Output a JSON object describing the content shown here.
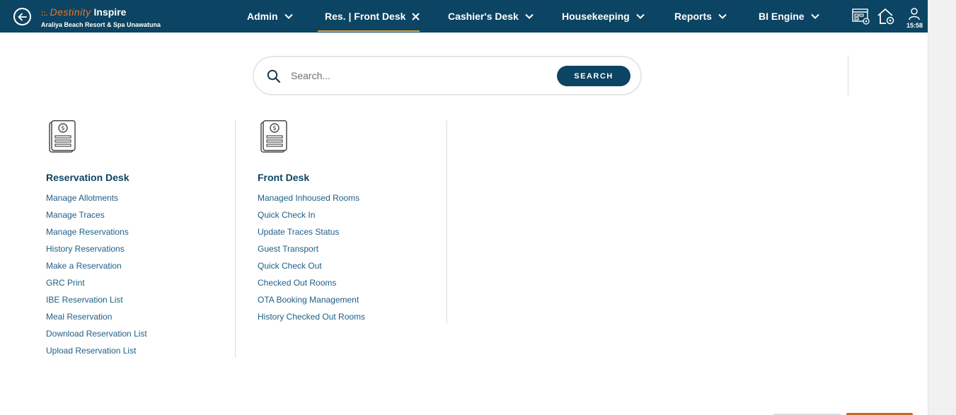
{
  "brand": {
    "logo_mark": "::.",
    "name_part1": "Destinity",
    "name_part2": "Inspire",
    "property": "Araliya Beach Resort & Spa Unawatuna"
  },
  "nav": {
    "items": [
      {
        "label": "Admin",
        "icon": "chevron-down-icon"
      },
      {
        "label": "Res. | Front Desk",
        "icon": "close-icon",
        "active": true
      },
      {
        "label": "Cashier's Desk",
        "icon": "chevron-down-icon"
      },
      {
        "label": "Housekeeping",
        "icon": "chevron-down-icon"
      },
      {
        "label": "Reports",
        "icon": "chevron-down-icon"
      },
      {
        "label": "BI Engine",
        "icon": "chevron-down-icon"
      }
    ]
  },
  "header_right": {
    "time": "15:58",
    "icons": [
      "dashboard-settings-icon",
      "home-settings-icon",
      "user-icon"
    ]
  },
  "search": {
    "placeholder": "Search...",
    "button_label": "SEARCH"
  },
  "sections": [
    {
      "title": "Reservation Desk",
      "icon": "invoice-document-icon",
      "links": [
        "Manage Allotments",
        "Manage Traces",
        "Manage Reservations",
        "History Reservations",
        "Make a Reservation",
        "GRC Print",
        "IBE Reservation List",
        "Meal Reservation",
        "Download Reservation List",
        "Upload Reservation List"
      ]
    },
    {
      "title": "Front Desk",
      "icon": "invoice-document-icon",
      "links": [
        "Managed Inhoused Rooms",
        "Quick Check In",
        "Update Traces Status",
        "Guest Transport",
        "Quick Check Out",
        "Checked Out Rooms",
        "OTA Booking Management",
        "History Checked Out Rooms"
      ]
    }
  ],
  "colors": {
    "header_bg": "#0c4463",
    "accent": "#e8762d",
    "link": "#1e5e86"
  }
}
